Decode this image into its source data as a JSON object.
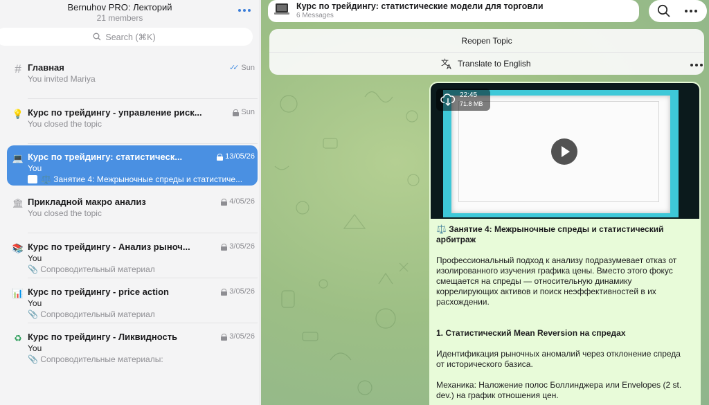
{
  "sidebar": {
    "title": "Bernuhov PRO: Лекторий",
    "members": "21 members",
    "search_placeholder": "Search (⌘K)",
    "items": [
      {
        "name": "Главная",
        "date": "Sun",
        "line2": "You invited Mariya",
        "line3": "",
        "icon": "hash-icon"
      },
      {
        "name": "Курс по трейдингу - управление риск...",
        "date": "Sun",
        "line2": "You closed the topic",
        "line3": "",
        "icon": "lightbulb-icon"
      },
      {
        "name": "Курс по трейдингу: статистическ...",
        "date": "13/05/26",
        "line2": "You",
        "line3": "⚖️ Занятие 4: Межрыночные спреды и статистиче...",
        "icon": "laptop-icon"
      },
      {
        "name": "Прикладной макро анализ",
        "date": "4/05/26",
        "line2": "You closed the topic",
        "line3": "",
        "icon": "bank-icon"
      },
      {
        "name": "Курс по трейдингу - Анализ рыноч...",
        "date": "3/05/26",
        "line2": "You",
        "line3": "📎 Сопроводительный материал",
        "icon": "books-icon"
      },
      {
        "name": "Курс по трейдингу - price action",
        "date": "3/05/26",
        "line2": "You",
        "line3": "📎 Сопроводительный материал",
        "icon": "chart-icon"
      },
      {
        "name": "Курс по трейдингу - Ликвидность",
        "date": "3/05/26",
        "line2": "You",
        "line3": "📎 Сопроводительные материалы:",
        "icon": "recycle-icon"
      }
    ]
  },
  "topic": {
    "title": "Курс по трейдингу: статистические модели для торговли",
    "subtitle": "6 Messages"
  },
  "panel": {
    "reopen": "Reopen Topic",
    "translate": "Translate to English"
  },
  "video": {
    "duration": "22:45",
    "size": "71.8 MB"
  },
  "message": {
    "heading": "⚖️ Занятие 4: Межрыночные спреды и статистический арбитраж",
    "p1": "Профессиональный подход к анализу подразумевает отказ от изолированного изучения графика цены. Вместо этого фокус смещается на спреды — относительную динамику коррелирующих активов и поиск неэффективностей в их расхождении.",
    "section": "1. Статистический Mean Reversion на спредах",
    "p2": "Идентификация рыночных аномалий через отклонение спреда от исторического базиса.",
    "p3": "Механика: Наложение полос Боллинджера или Envelopes (2 st. dev.) на график отношения цен."
  },
  "colors": {
    "accent": "#4a90e2",
    "bubble": "#e8fbd9"
  }
}
